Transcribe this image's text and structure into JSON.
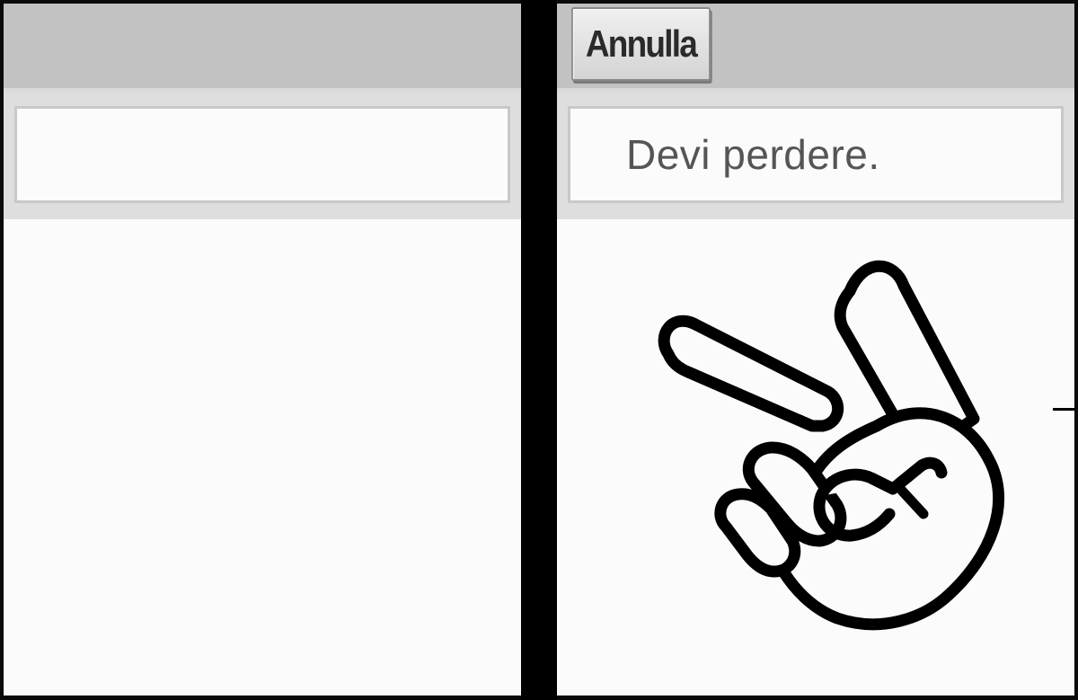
{
  "right_panel": {
    "cancel_label": "Annulla",
    "message": "Devi perdere."
  },
  "left_panel": {
    "message": ""
  },
  "icons": {
    "gesture": "peace-hand-icon"
  },
  "colors": {
    "header_gray": "#c2c2c2",
    "panel_bg": "#fbfbfb",
    "divider": "#000000",
    "message_text": "#555555"
  }
}
